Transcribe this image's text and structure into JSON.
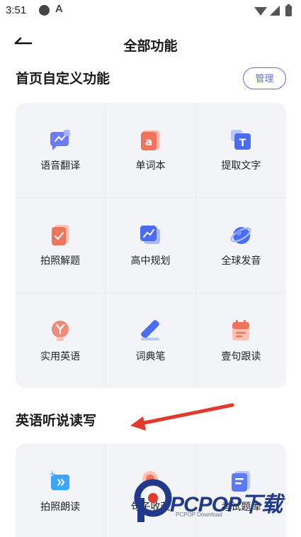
{
  "status_bar": {
    "time": "3:51",
    "letter": "A"
  },
  "header": {
    "title": "全部功能"
  },
  "sections": {
    "custom": {
      "title": "首页自定义功能",
      "manage_label": "管理",
      "items": [
        {
          "label": "语音翻译",
          "icon": "voice-translate-icon"
        },
        {
          "label": "单词本",
          "icon": "wordbook-icon"
        },
        {
          "label": "提取文字",
          "icon": "extract-text-icon"
        },
        {
          "label": "拍照解题",
          "icon": "photo-solve-icon"
        },
        {
          "label": "高中规划",
          "icon": "highschool-plan-icon"
        },
        {
          "label": "全球发音",
          "icon": "global-pronunciation-icon"
        },
        {
          "label": "实用英语",
          "icon": "practical-english-icon"
        },
        {
          "label": "词典笔",
          "icon": "dictionary-pen-icon"
        },
        {
          "label": "壹句跟读",
          "icon": "sentence-follow-icon"
        }
      ]
    },
    "english": {
      "title": "英语听说读写",
      "items": [
        {
          "label": "拍照朗读",
          "icon": "photo-read-icon"
        },
        {
          "label": "句子收藏",
          "icon": "sentence-collect-icon"
        },
        {
          "label": "考试题库",
          "icon": "exam-bank-icon"
        }
      ]
    }
  },
  "watermark": {
    "text": "PCPOP下载",
    "sub": "PCPOP Download"
  },
  "colors": {
    "accent": "#5b6fe6",
    "card_bg": "#f3f4f8",
    "arrow": "#e03a2f"
  }
}
